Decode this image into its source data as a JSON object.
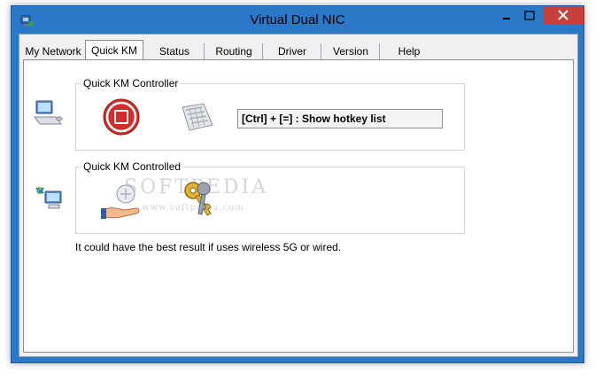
{
  "window": {
    "title": "Virtual Dual NIC",
    "colors": {
      "frame": "#2b78c9",
      "close_button": "#c7403b",
      "stop_button": "#d52b2b"
    }
  },
  "window_controls": {
    "minimize": "–",
    "maximize": "□",
    "close": "✕"
  },
  "tabs": [
    {
      "label": "My Network"
    },
    {
      "label": "Quick KM",
      "active": true
    },
    {
      "label": "Status"
    },
    {
      "label": "Routing"
    },
    {
      "label": "Driver"
    },
    {
      "label": "Version"
    },
    {
      "label": "Help"
    }
  ],
  "controller_group": {
    "title": "Quick KM Controller",
    "hotkey_text": "[Ctrl] + [=] : Show hotkey list"
  },
  "controlled_group": {
    "title": "Quick KM Controlled"
  },
  "note": "It could have the best result if uses wireless 5G or wired.",
  "watermark": {
    "text": "SOFTPEDIA",
    "url": "www.softpedia.com"
  },
  "icons": {
    "app": "network-card-icon",
    "controller_side": "computer-icon",
    "controlled_side": "network-computer-icon",
    "stop": "stop-icon",
    "keyboard": "keyboard-icon",
    "share": "share-hand-icon",
    "keys": "keys-icon"
  }
}
